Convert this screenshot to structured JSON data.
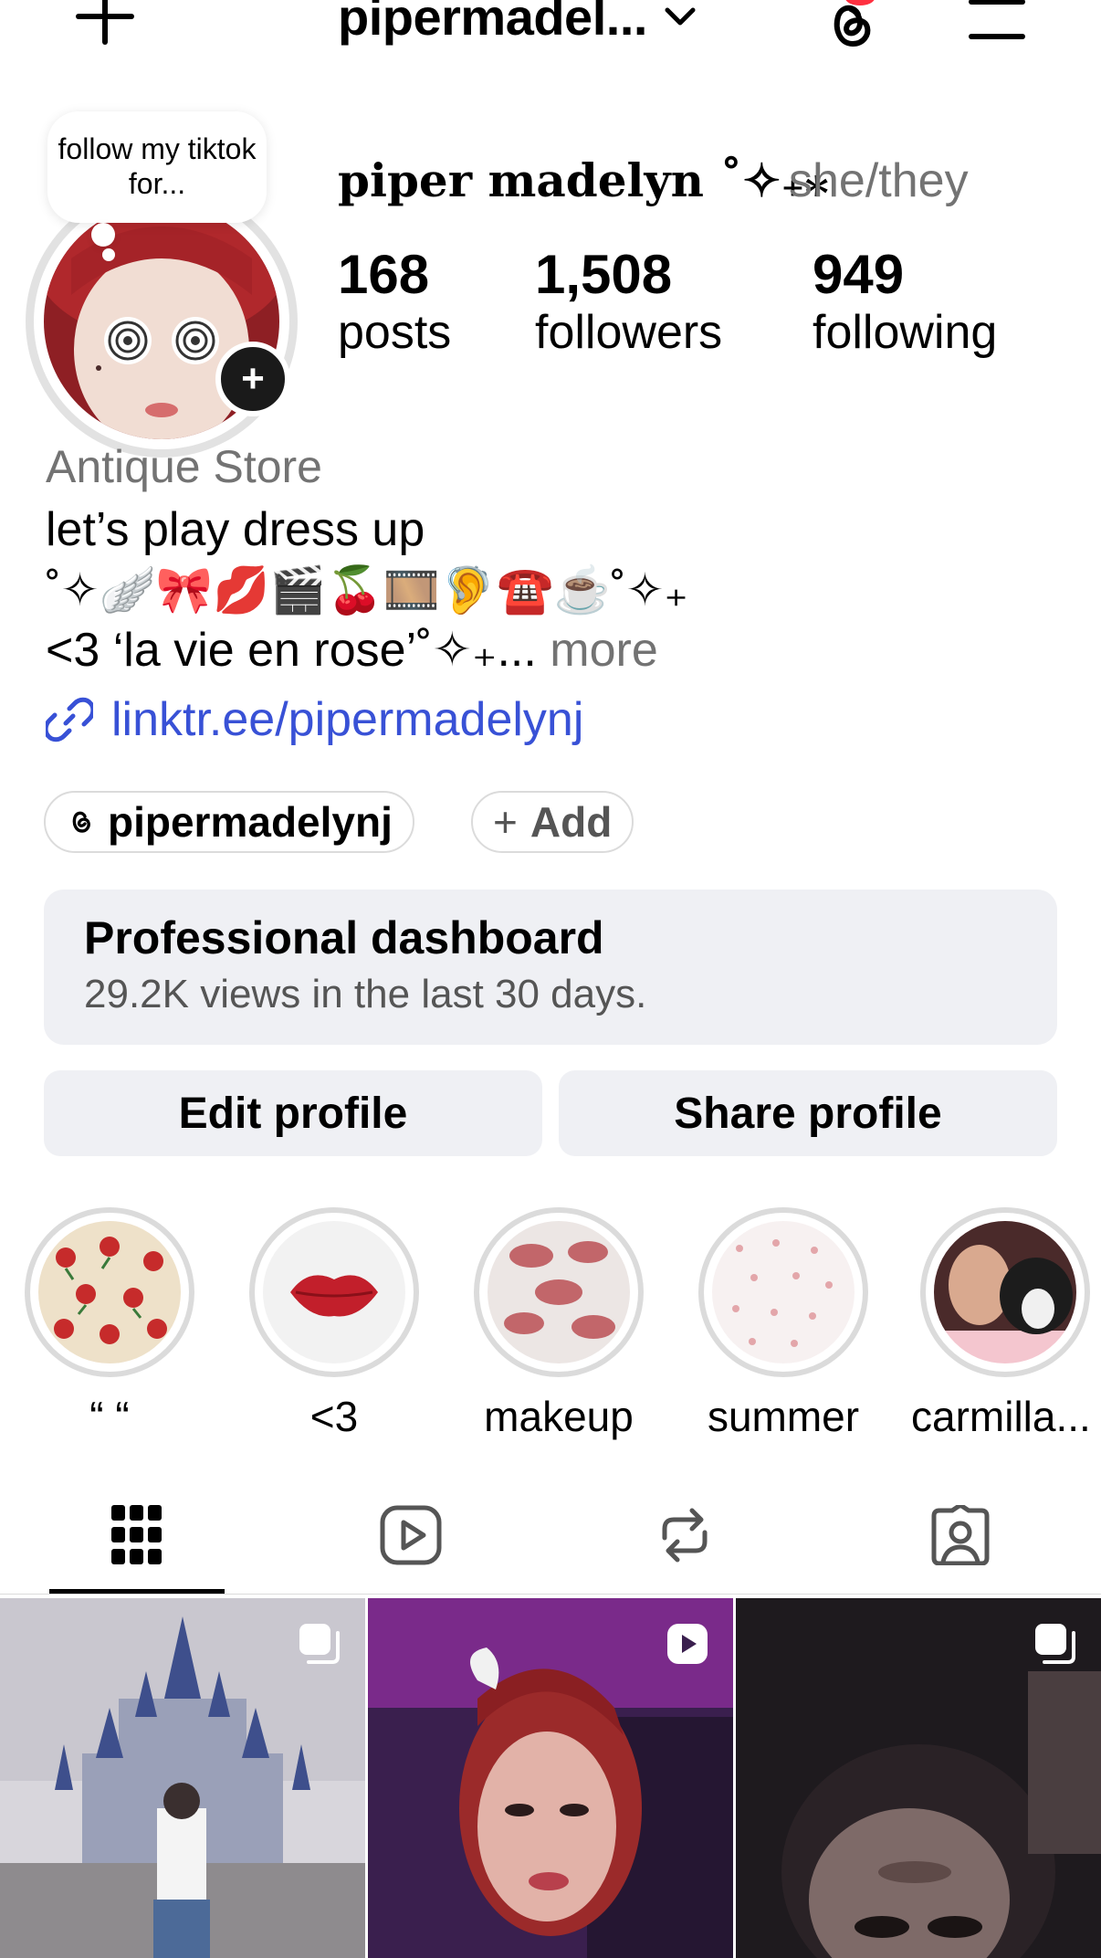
{
  "header": {
    "username": "pipermadel...",
    "icons": [
      "plus-icon",
      "chevron-down-icon",
      "threads-icon",
      "menu-icon"
    ],
    "threads_badge_color": "#ff3040"
  },
  "profile": {
    "note": "follow my tiktok for...",
    "display_name": "piper madelyn ˚✧₊⁎",
    "pronouns": "she/they",
    "stats": [
      {
        "value": "168",
        "label": "posts"
      },
      {
        "value": "1,508",
        "label": "followers"
      },
      {
        "value": "949",
        "label": "following"
      }
    ],
    "category": "Antique Store",
    "bio": {
      "line1": "let’s play dress up",
      "line2": "˚✧🪽🎀💋🎬🍒🎞️🦻☎️☕˚✧₊",
      "line3": "<3 ‘la vie en rose’˚✧₊...",
      "more": " more"
    },
    "link": "linktr.ee/pipermadelynj",
    "threads_handle": "pipermadelynj",
    "add_label": "Add"
  },
  "dashboard": {
    "title": "Professional dashboard",
    "subtitle": "29.2K views in the last 30 days."
  },
  "buttons": {
    "edit": "Edit profile",
    "share": "Share profile"
  },
  "highlights": [
    {
      "label": "“ “"
    },
    {
      "label": "<3"
    },
    {
      "label": "makeup"
    },
    {
      "label": "summer"
    },
    {
      "label": "carmilla..."
    }
  ],
  "tabs": [
    "grid-icon",
    "reels-icon",
    "reposts-icon",
    "tagged-icon"
  ],
  "colors": {
    "link": "#3851d6",
    "muted": "#737373",
    "surface": "#eff0f4"
  }
}
